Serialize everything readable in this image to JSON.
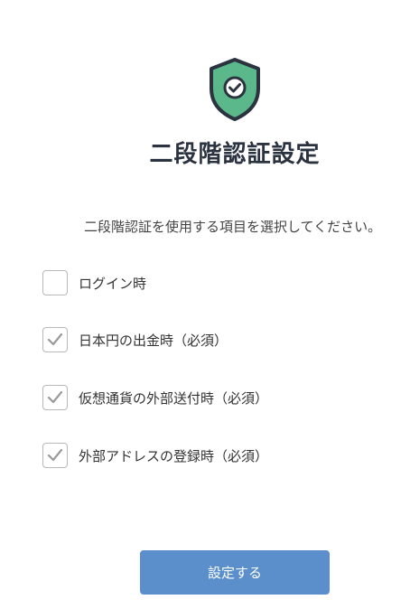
{
  "header": {
    "icon": "shield-check-icon",
    "title": "二段階認証設定"
  },
  "instruction": "二段階認証を使用する項目を選択してください。",
  "options": [
    {
      "label": "ログイン時",
      "checked": false
    },
    {
      "label": "日本円の出金時（必須）",
      "checked": true
    },
    {
      "label": "仮想通貨の外部送付時（必須）",
      "checked": true
    },
    {
      "label": "外部アドレスの登録時（必須）",
      "checked": true
    }
  ],
  "submit_label": "設定する",
  "colors": {
    "shield_green": "#5bb88a",
    "shield_outline": "#2c3340",
    "button_blue": "#5b8fcc",
    "checkmark_gray": "#9a9a9a"
  }
}
